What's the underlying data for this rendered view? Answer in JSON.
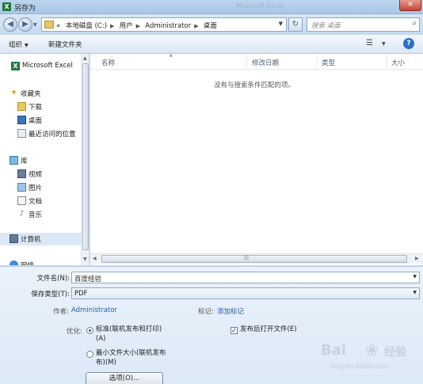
{
  "window": {
    "title": "另存为",
    "background_title": "Microsoft Excel",
    "close_label": "✕"
  },
  "address_bar": {
    "crumbs": [
      "«",
      "本地磁盘 (C:)",
      "用户",
      "Administrator",
      "桌面"
    ],
    "search_placeholder": "搜索 桌面"
  },
  "toolbar": {
    "organize_label": "组织",
    "new_folder_label": "新建文件夹",
    "help_label": "?"
  },
  "nav_pane": {
    "items": [
      {
        "label": "Microsoft Excel",
        "icon": "excel-icon",
        "glyph": "X"
      },
      {
        "label": "收藏夹",
        "icon": "star-icon",
        "glyph": "★"
      },
      {
        "label": "下载",
        "icon": "download-folder-icon",
        "glyph": ""
      },
      {
        "label": "桌面",
        "icon": "desktop-icon",
        "glyph": ""
      },
      {
        "label": "最近访问的位置",
        "icon": "recent-places-icon",
        "glyph": ""
      },
      {
        "label": "库",
        "icon": "library-icon",
        "glyph": ""
      },
      {
        "label": "视频",
        "icon": "video-icon",
        "glyph": ""
      },
      {
        "label": "图片",
        "icon": "pictures-icon",
        "glyph": ""
      },
      {
        "label": "文档",
        "icon": "documents-icon",
        "glyph": ""
      },
      {
        "label": "音乐",
        "icon": "music-icon",
        "glyph": "♪"
      },
      {
        "label": "计算机",
        "icon": "computer-icon",
        "glyph": ""
      },
      {
        "label": "网络",
        "icon": "network-icon",
        "glyph": ""
      }
    ]
  },
  "file_list": {
    "columns": [
      "名称",
      "修改日期",
      "类型",
      "大小"
    ],
    "empty_message": "没有与搜索条件匹配的项。"
  },
  "form": {
    "filename_label": "文件名(N):",
    "filename_value": "百度经验",
    "filetype_label": "保存类型(T):",
    "filetype_value": "PDF",
    "author_label": "作者:",
    "author_value": "Administrator",
    "tags_label": "标记:",
    "tags_value": "添加标记",
    "optimize_label": "优化:",
    "option_standard": "标准(联机发布和打印)\n(A)",
    "option_minimum": "最小文件大小(联机发布\n布)(M)",
    "open_after_publish_label": "发布后打开文件(E)",
    "open_after_publish_checked": true,
    "options_button": "选项(O)..."
  },
  "watermark": {
    "logo": "Bai",
    "brand": "经验",
    "url": "jingyan.baidu.com"
  }
}
